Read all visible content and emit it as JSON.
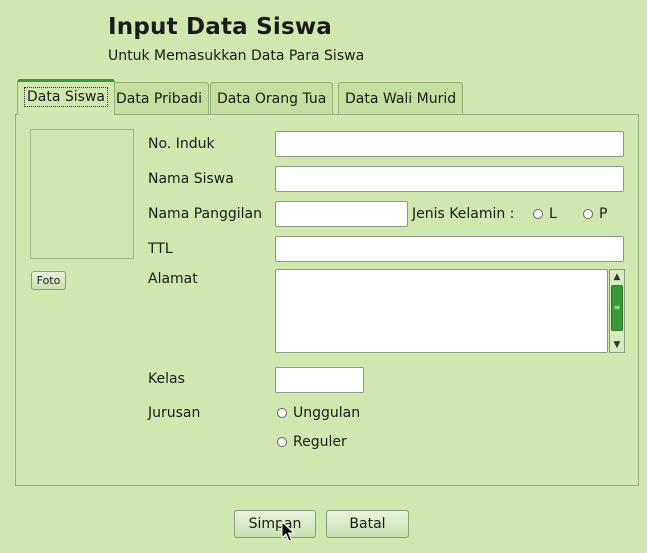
{
  "header": {
    "title": "Input Data Siswa",
    "subtitle": "Untuk Memasukkan Data Para Siswa"
  },
  "tabs": [
    {
      "label": "Data Siswa",
      "active": true
    },
    {
      "label": "Data Pribadi",
      "active": false
    },
    {
      "label": "Data Orang Tua",
      "active": false
    },
    {
      "label": "Data Wali Murid",
      "active": false
    }
  ],
  "photo": {
    "button_label": "Foto"
  },
  "form": {
    "no_induk": {
      "label": "No. Induk",
      "value": ""
    },
    "nama_siswa": {
      "label": "Nama Siswa",
      "value": ""
    },
    "nama_panggilan": {
      "label": "Nama Panggilan",
      "value": ""
    },
    "jenis_kelamin": {
      "label": "Jenis Kelamin :",
      "options": [
        "L",
        "P"
      ]
    },
    "ttl": {
      "label": "TTL",
      "value": ""
    },
    "alamat": {
      "label": "Alamat",
      "value": ""
    },
    "kelas": {
      "label": "Kelas",
      "value": ""
    },
    "jurusan": {
      "label": "Jurusan",
      "options": [
        "Unggulan",
        "Reguler"
      ]
    }
  },
  "actions": {
    "save_label": "Simpan",
    "cancel_label": "Batal"
  },
  "theme": {
    "background": "#d0e8b0",
    "accent": "#3a9a3a"
  },
  "icons": {
    "scroll_up": "chevron-up-icon",
    "scroll_down": "chevron-down-icon",
    "cursor": "mouse-pointer-icon"
  }
}
